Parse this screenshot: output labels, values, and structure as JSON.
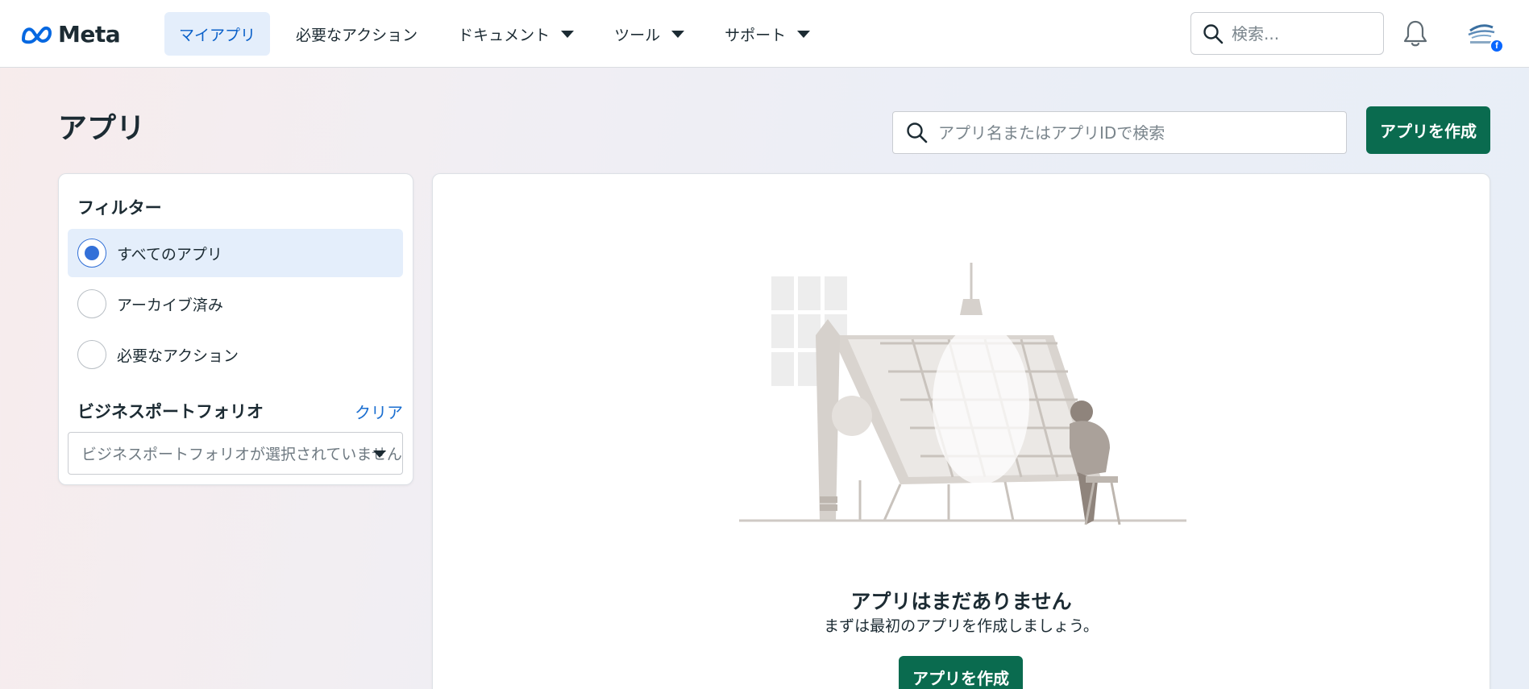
{
  "header": {
    "brand": "Meta",
    "nav": [
      {
        "label": "マイアプリ",
        "active": true
      },
      {
        "label": "必要なアクション"
      },
      {
        "label": "ドキュメント",
        "dropdown": true
      },
      {
        "label": "ツール",
        "dropdown": true
      },
      {
        "label": "サポート",
        "dropdown": true
      }
    ],
    "search_placeholder": "検索...",
    "icons": [
      "meta-logo-icon",
      "search-icon",
      "bell-icon",
      "avatar"
    ],
    "avatar_badge": "f"
  },
  "page": {
    "title": "アプリ",
    "search_placeholder": "アプリ名またはアプリIDで検索",
    "create_button": "アプリを作成"
  },
  "filter": {
    "title": "フィルター",
    "options": [
      {
        "label": "すべてのアプリ",
        "selected": true
      },
      {
        "label": "アーカイブ済み",
        "selected": false
      },
      {
        "label": "必要なアクション",
        "selected": false
      }
    ],
    "business_portfolio": {
      "title": "ビジネスポートフォリオ",
      "clear": "クリア",
      "select_value": "ビジネスポートフォリオが選択されていません"
    }
  },
  "empty_state": {
    "title": "アプリはまだありません",
    "subtitle": "まずは最初のアプリを作成しましょう。",
    "create_button": "アプリを作成"
  },
  "colors": {
    "primary_green": "#0a6b4f",
    "active_blue": "#0a60c9",
    "link_blue": "#1a6ed0",
    "selected_bg": "#e4eefb"
  }
}
